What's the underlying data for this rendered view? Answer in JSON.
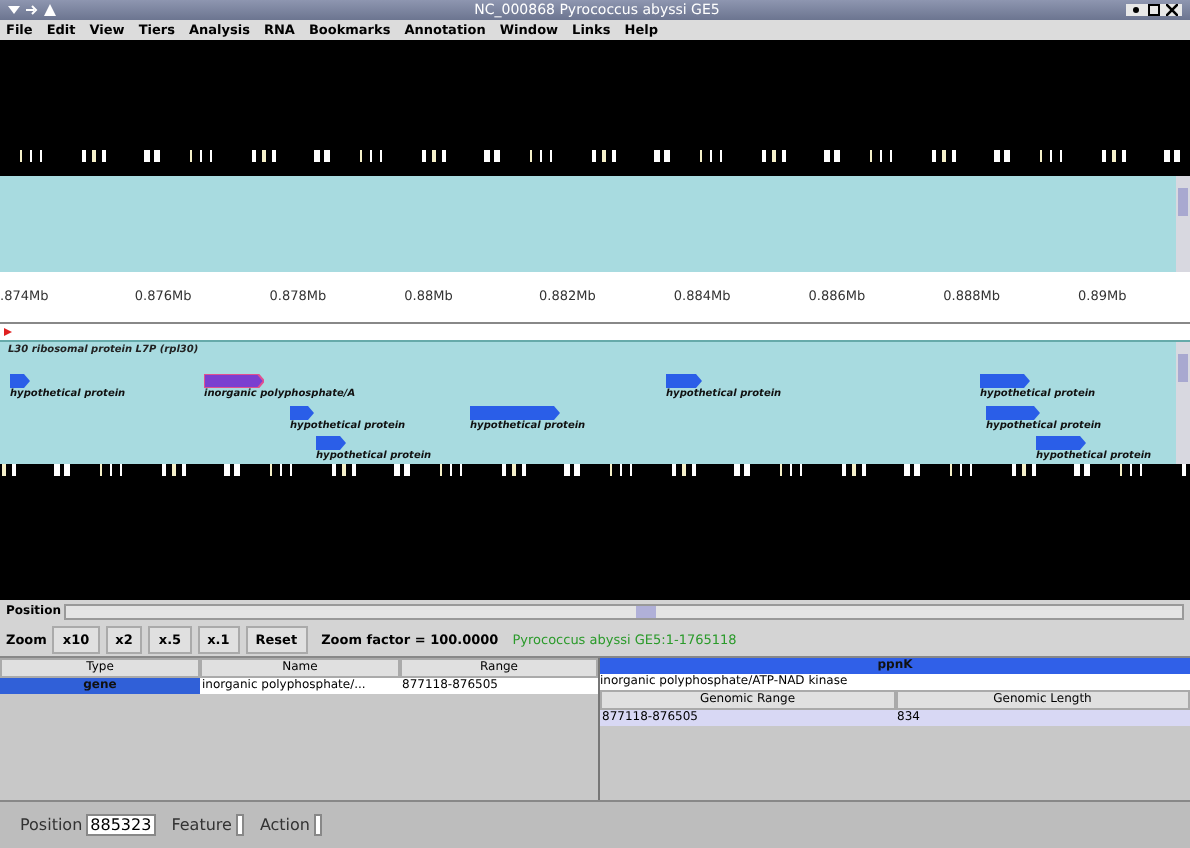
{
  "window": {
    "title": "NC_000868 Pyrococcus abyssi GE5"
  },
  "menu": [
    "File",
    "Edit",
    "View",
    "Tiers",
    "Analysis",
    "RNA",
    "Bookmarks",
    "Annotation",
    "Window",
    "Links",
    "Help"
  ],
  "ruler": {
    "labels": [
      ".874Mb",
      "0.876Mb",
      "0.878Mb",
      "0.88Mb",
      "0.882Mb",
      "0.884Mb",
      "0.886Mb",
      "0.888Mb",
      "0.89Mb"
    ]
  },
  "track": {
    "title": "L30 ribosomal protein L7P (rpl30)",
    "features": [
      {
        "label": "hypothetical protein",
        "selected": false
      },
      {
        "label": "inorganic polyphosphate/A",
        "selected": true
      },
      {
        "label": "hypothetical protein",
        "selected": false
      },
      {
        "label": "hypothetical protein",
        "selected": false
      },
      {
        "label": "hypothetical protein",
        "selected": false
      },
      {
        "label": "hypothetical protein",
        "selected": false
      },
      {
        "label": "hypothetical protein",
        "selected": false
      },
      {
        "label": "hypothetical protein",
        "selected": false
      },
      {
        "label": "hypothetical protein",
        "selected": false
      }
    ]
  },
  "position_bar": {
    "label": "Position"
  },
  "zoom": {
    "label": "Zoom",
    "buttons": [
      "x10",
      "x2",
      "x.5",
      "x.1",
      "Reset"
    ],
    "factor": "Zoom factor = 100.0000",
    "region": "Pyrococcus abyssi GE5:1-1765118"
  },
  "feature_table": {
    "columns": [
      "Type",
      "Name",
      "Range"
    ],
    "rows": [
      {
        "cells": [
          "gene",
          "inorganic polyphosphate/...",
          "877118-876505"
        ],
        "selected": true
      }
    ]
  },
  "detail": {
    "title": "ppnK",
    "description": "inorganic polyphosphate/ATP-NAD kinase",
    "columns": [
      "Genomic Range",
      "Genomic Length"
    ],
    "rows": [
      [
        "877118-876505",
        "834"
      ]
    ]
  },
  "status_bar": {
    "fields": [
      {
        "label": "Position",
        "value": "885323"
      },
      {
        "label": "Feature"
      },
      {
        "label": "Action"
      }
    ]
  }
}
